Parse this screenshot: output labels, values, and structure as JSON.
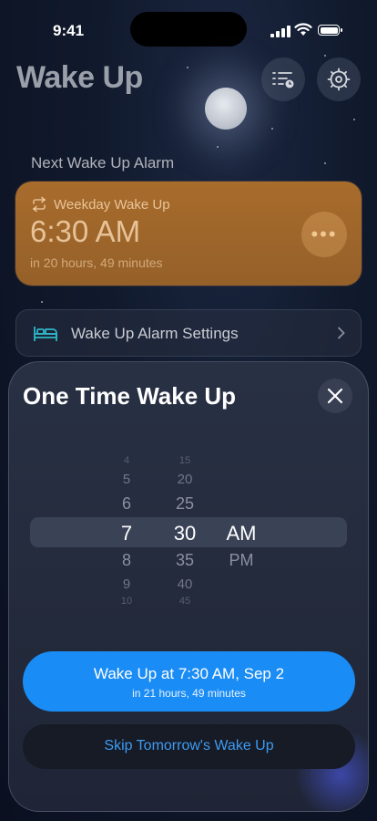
{
  "status_bar": {
    "time": "9:41"
  },
  "header": {
    "title": "Wake Up"
  },
  "next_alarm": {
    "section_label": "Next Wake Up Alarm",
    "name": "Weekday Wake Up",
    "time": "6:30 AM",
    "remaining": "in 20 hours, 49 minutes"
  },
  "settings_row": {
    "label": "Wake Up Alarm Settings"
  },
  "sheet": {
    "title": "One Time Wake Up",
    "picker": {
      "hours": [
        "4",
        "5",
        "6",
        "7",
        "8",
        "9",
        "10"
      ],
      "minutes": [
        "15",
        "20",
        "25",
        "30",
        "35",
        "40",
        "45"
      ],
      "periods": [
        "AM",
        "PM"
      ],
      "selected": {
        "hour": "7",
        "minute": "30",
        "period": "AM"
      }
    },
    "primary_button": {
      "label": "Wake Up at 7:30 AM, Sep 2",
      "sub": "in 21 hours, 49 minutes"
    },
    "secondary_button": {
      "label": "Skip Tomorrow's Wake Up"
    }
  },
  "colors": {
    "accent_blue": "#1a8cf5",
    "alarm_card": "#a86c2c",
    "background": "#0b1222"
  },
  "icons": [
    "signal-icon",
    "wifi-icon",
    "battery-icon",
    "schedule-list-icon",
    "gear-icon",
    "repeat-icon",
    "more-icon",
    "bed-icon",
    "chevron-right-icon",
    "close-icon"
  ]
}
